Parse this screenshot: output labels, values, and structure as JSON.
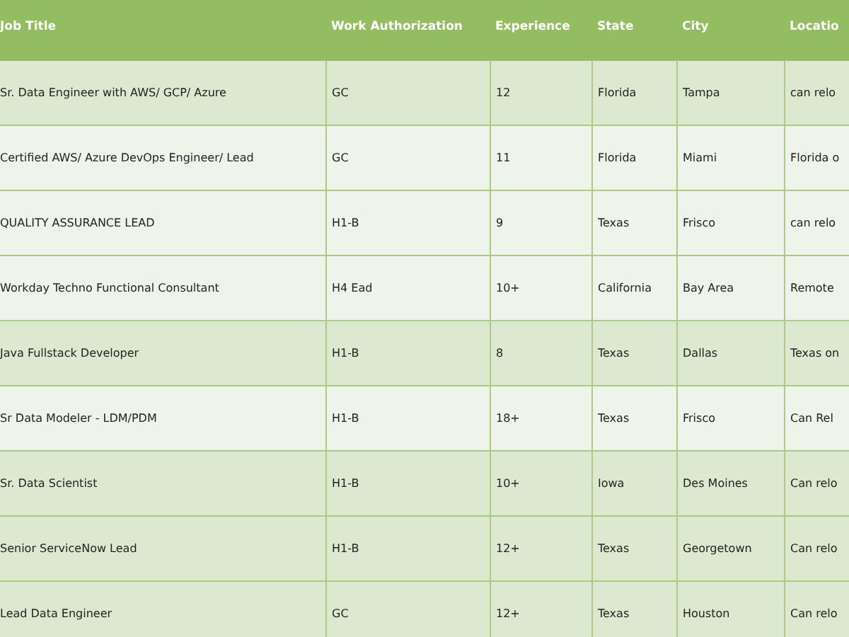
{
  "table": {
    "columns": [
      "Job Title",
      "Work Authorization",
      "Experience",
      "State",
      "City",
      "Locatio"
    ],
    "rows": [
      {
        "shaded": true,
        "cells": [
          "Sr. Data Engineer with AWS/ GCP/ Azure",
          "GC",
          "12",
          "Florida",
          "Tampa",
          "can relo"
        ]
      },
      {
        "shaded": false,
        "cells": [
          "Certified AWS/ Azure DevOps Engineer/ Lead",
          "GC",
          "11",
          "Florida",
          "Miami",
          "Florida o"
        ]
      },
      {
        "shaded": false,
        "cells": [
          "QUALITY ASSURANCE LEAD",
          "H1-B",
          "9",
          "Texas",
          "Frisco",
          "can relo"
        ]
      },
      {
        "shaded": false,
        "cells": [
          "Workday Techno Functional Consultant",
          "H4 Ead",
          "10+",
          "California",
          "Bay Area",
          "Remote"
        ]
      },
      {
        "shaded": true,
        "cells": [
          "Java Fullstack Developer",
          "H1-B",
          "8",
          "Texas",
          "Dallas",
          "Texas on"
        ]
      },
      {
        "shaded": false,
        "cells": [
          "Sr Data Modeler - LDM/PDM",
          "H1-B",
          "18+",
          "Texas",
          "Frisco",
          "Can Rel"
        ]
      },
      {
        "shaded": true,
        "cells": [
          "Sr. Data Scientist",
          "H1-B",
          "10+",
          "Iowa",
          "Des Moines",
          "Can relo"
        ]
      },
      {
        "shaded": true,
        "cells": [
          "Senior ServiceNow Lead",
          "H1-B",
          "12+",
          "Texas",
          "Georgetown",
          "Can relo"
        ]
      },
      {
        "shaded": true,
        "cells": [
          "Lead Data Engineer",
          "GC",
          "12+",
          "Texas",
          "Houston",
          "Can relo"
        ]
      }
    ]
  }
}
